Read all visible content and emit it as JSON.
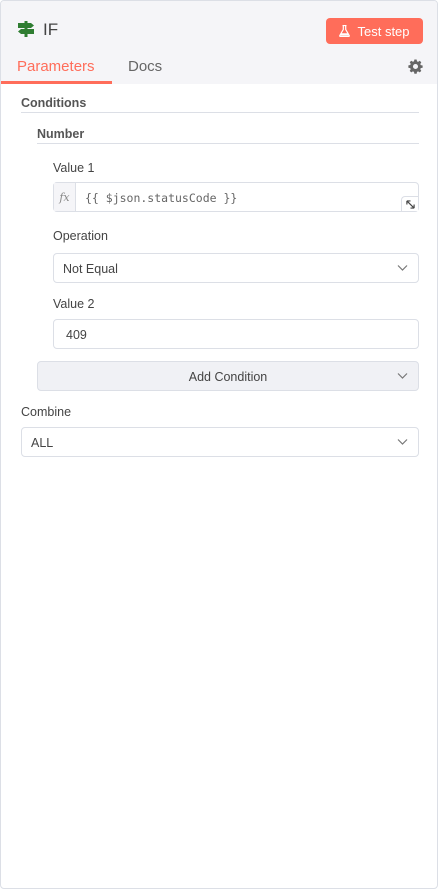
{
  "node": {
    "title": "IF",
    "icon": "signpost-icon",
    "test_button_label": "Test step",
    "test_button_icon": "flask-icon"
  },
  "tabs": [
    {
      "label": "Parameters",
      "active": true
    },
    {
      "label": "Docs",
      "active": false
    }
  ],
  "colors": {
    "accent": "#ff6d5a",
    "node_icon": "#2f7d32",
    "header_bg": "#f5f5f8"
  },
  "parameters": {
    "conditions_label": "Conditions",
    "number_label": "Number",
    "value1": {
      "label": "Value 1",
      "prefix": "fx",
      "expression": "{{ $json.statusCode }}"
    },
    "operation": {
      "label": "Operation",
      "selected": "Not Equal"
    },
    "value2": {
      "label": "Value 2",
      "value": "409"
    },
    "add_condition_label": "Add Condition",
    "combine": {
      "label": "Combine",
      "selected": "ALL"
    }
  }
}
